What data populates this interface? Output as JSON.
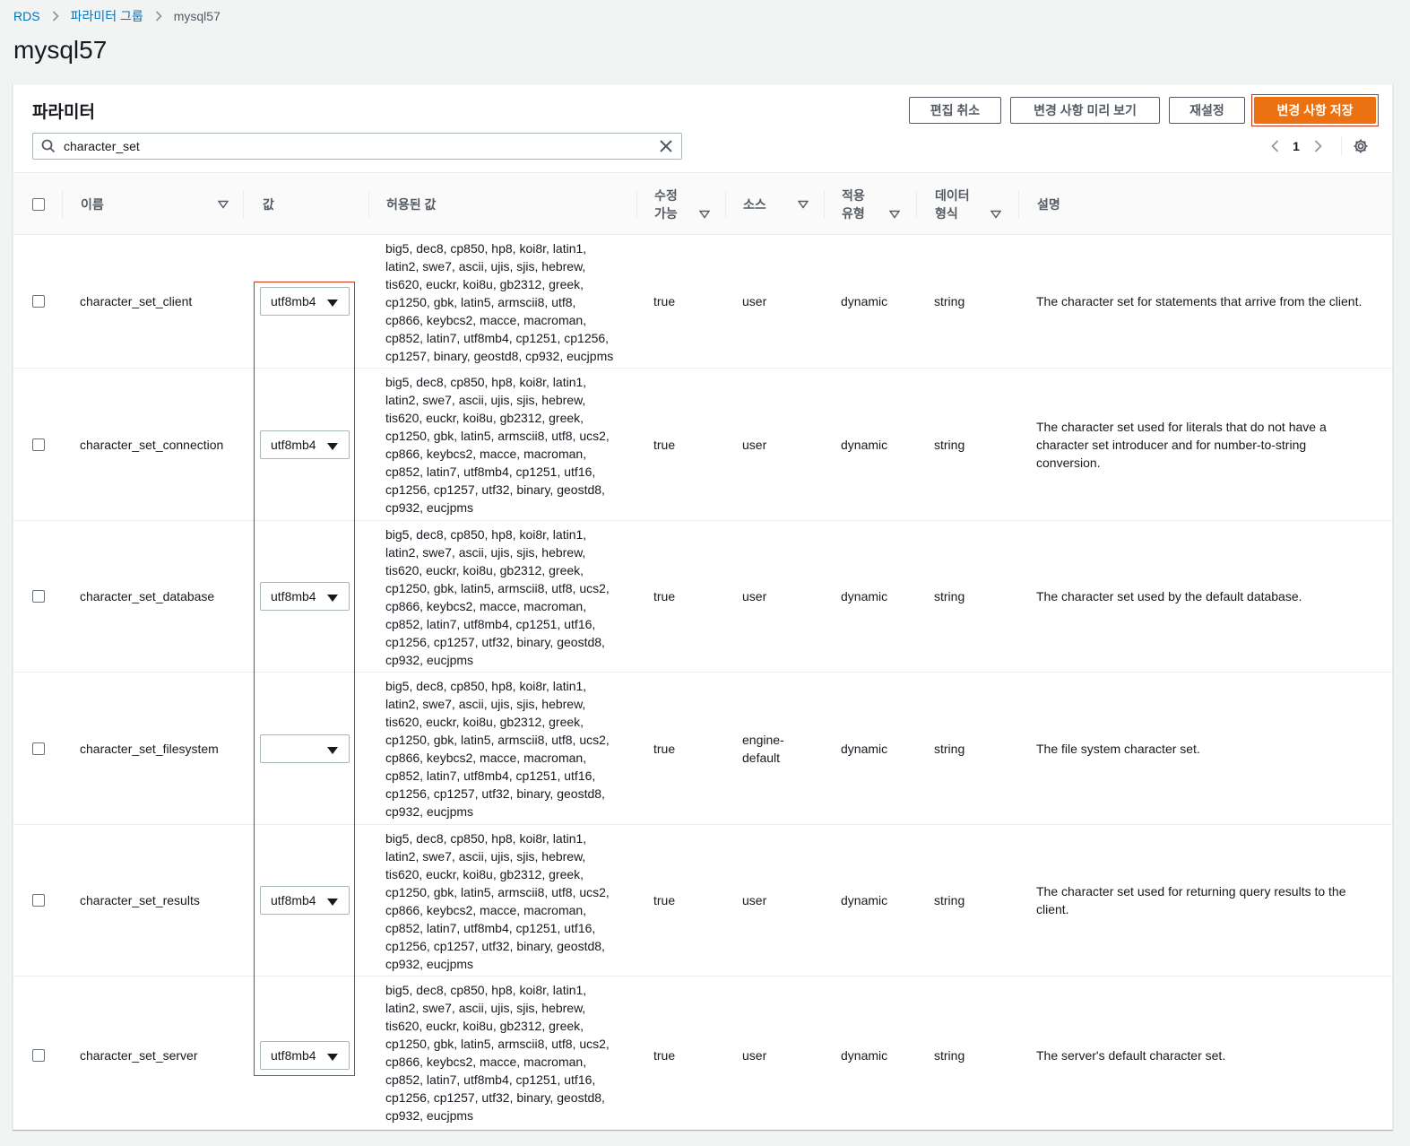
{
  "breadcrumb": [
    "RDS",
    "파라미터 그룹",
    "mysql57"
  ],
  "page_title": "mysql57",
  "panel": {
    "title": "파라미터",
    "buttons": {
      "cancel_edit": "편집 취소",
      "preview_changes": "변경 사항 미리 보기",
      "reset": "재설정",
      "save_changes": "변경 사항 저장"
    },
    "search_value": "character_set",
    "page_number": "1"
  },
  "columns": {
    "name": "이름",
    "value": "값",
    "allowed": "허용된 값",
    "modifiable_l1": "수정",
    "modifiable_l2": "가능",
    "source": "소스",
    "apply_l1": "적용",
    "apply_l2": "유형",
    "datatype_l1": "데이터",
    "datatype_l2": "형식",
    "description": "설명"
  },
  "rows": [
    {
      "name": "character_set_client",
      "value": "utf8mb4",
      "allowed": [
        "big5, dec8, cp850, hp8, koi8r, latin1,",
        "latin2, swe7, ascii, ujis, sjis, hebrew,",
        "tis620, euckr, koi8u, gb2312, greek,",
        "cp1250, gbk, latin5, armscii8, utf8,",
        "cp866, keybcs2, macce, macroman,",
        "cp852, latin7, utf8mb4, cp1251, cp1256,",
        "cp1257, binary, geostd8, cp932, eucjpms"
      ],
      "modifiable": "true",
      "source": [
        "user"
      ],
      "apply_type": "dynamic",
      "data_type": "string",
      "description": [
        "The character set for statements that arrive from the client."
      ]
    },
    {
      "name": "character_set_connection",
      "value": "utf8mb4",
      "allowed": [
        "big5, dec8, cp850, hp8, koi8r, latin1,",
        "latin2, swe7, ascii, ujis, sjis, hebrew,",
        "tis620, euckr, koi8u, gb2312, greek,",
        "cp1250, gbk, latin5, armscii8, utf8, ucs2,",
        "cp866, keybcs2, macce, macroman,",
        "cp852, latin7, utf8mb4, cp1251, utf16,",
        "cp1256, cp1257, utf32, binary, geostd8,",
        "cp932, eucjpms"
      ],
      "modifiable": "true",
      "source": [
        "user"
      ],
      "apply_type": "dynamic",
      "data_type": "string",
      "description": [
        "The character set used for literals that do not have a",
        "character set introducer and for number-to-string",
        "conversion."
      ]
    },
    {
      "name": "character_set_database",
      "value": "utf8mb4",
      "allowed": [
        "big5, dec8, cp850, hp8, koi8r, latin1,",
        "latin2, swe7, ascii, ujis, sjis, hebrew,",
        "tis620, euckr, koi8u, gb2312, greek,",
        "cp1250, gbk, latin5, armscii8, utf8, ucs2,",
        "cp866, keybcs2, macce, macroman,",
        "cp852, latin7, utf8mb4, cp1251, utf16,",
        "cp1256, cp1257, utf32, binary, geostd8,",
        "cp932, eucjpms"
      ],
      "modifiable": "true",
      "source": [
        "user"
      ],
      "apply_type": "dynamic",
      "data_type": "string",
      "description": [
        "The character set used by the default database."
      ]
    },
    {
      "name": "character_set_filesystem",
      "value": "",
      "allowed": [
        "big5, dec8, cp850, hp8, koi8r, latin1,",
        "latin2, swe7, ascii, ujis, sjis, hebrew,",
        "tis620, euckr, koi8u, gb2312, greek,",
        "cp1250, gbk, latin5, armscii8, utf8, ucs2,",
        "cp866, keybcs2, macce, macroman,",
        "cp852, latin7, utf8mb4, cp1251, utf16,",
        "cp1256, cp1257, utf32, binary, geostd8,",
        "cp932, eucjpms"
      ],
      "modifiable": "true",
      "source": [
        "engine-",
        "default"
      ],
      "apply_type": "dynamic",
      "data_type": "string",
      "description": [
        "The file system character set."
      ]
    },
    {
      "name": "character_set_results",
      "value": "utf8mb4",
      "allowed": [
        "big5, dec8, cp850, hp8, koi8r, latin1,",
        "latin2, swe7, ascii, ujis, sjis, hebrew,",
        "tis620, euckr, koi8u, gb2312, greek,",
        "cp1250, gbk, latin5, armscii8, utf8, ucs2,",
        "cp866, keybcs2, macce, macroman,",
        "cp852, latin7, utf8mb4, cp1251, utf16,",
        "cp1256, cp1257, utf32, binary, geostd8,",
        "cp932, eucjpms"
      ],
      "modifiable": "true",
      "source": [
        "user"
      ],
      "apply_type": "dynamic",
      "data_type": "string",
      "description": [
        "The character set used for returning query results to the",
        "client."
      ]
    },
    {
      "name": "character_set_server",
      "value": "utf8mb4",
      "allowed": [
        "big5, dec8, cp850, hp8, koi8r, latin1,",
        "latin2, swe7, ascii, ujis, sjis, hebrew,",
        "tis620, euckr, koi8u, gb2312, greek,",
        "cp1250, gbk, latin5, armscii8, utf8, ucs2,",
        "cp866, keybcs2, macce, macroman,",
        "cp852, latin7, utf8mb4, cp1251, utf16,",
        "cp1256, cp1257, utf32, binary, geostd8,",
        "cp932, eucjpms"
      ],
      "modifiable": "true",
      "source": [
        "user"
      ],
      "apply_type": "dynamic",
      "data_type": "string",
      "description": [
        "The server's default character set."
      ]
    }
  ],
  "colors": {
    "primary": "#ec7211",
    "link": "#0073bb",
    "highlight": "#d13212"
  }
}
